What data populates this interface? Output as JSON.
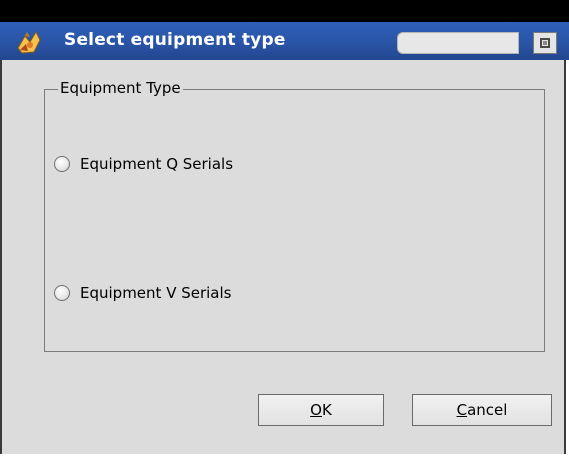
{
  "window": {
    "title": "Select equipment type",
    "app_icon": "app-logo-icon",
    "title_field_value": "",
    "restore_icon": "restore-icon"
  },
  "group": {
    "legend": "Equipment Type",
    "options": [
      {
        "label": "Equipment Q Serials",
        "selected": false
      },
      {
        "label": "Equipment V Serials",
        "selected": false
      }
    ]
  },
  "buttons": {
    "ok_mnemonic": "O",
    "ok_rest": "K",
    "cancel_mnemonic": "C",
    "cancel_rest": "ancel"
  },
  "colors": {
    "titlebar": "#2a55a8",
    "dialog_bg": "#dcdcdc",
    "title_text": "#ffffff"
  }
}
